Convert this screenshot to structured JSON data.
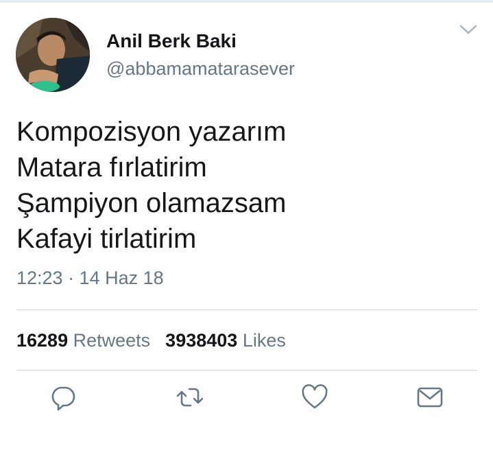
{
  "user": {
    "name": "Anil Berk Baki",
    "handle": "@abbamamatarasever",
    "avatar_icon": "profile-photo"
  },
  "tweet": {
    "lines": [
      "Kompozisyon yazarım",
      "Matara fırlatirim",
      "Şampiyon olamazsam",
      "Kafayi tirlatirim"
    ],
    "timestamp": "12:23 · 14 Haz 18"
  },
  "stats": {
    "retweets_count": "16289",
    "retweets_label": "Retweets",
    "likes_count": "3938403",
    "likes_label": "Likes"
  },
  "actions": {
    "icons": [
      "reply-icon",
      "retweet-icon",
      "like-icon",
      "share-icon"
    ]
  },
  "colors": {
    "primary_text": "#14171a",
    "secondary_text": "#657786",
    "divider": "#ccd6dd",
    "icon": "#657786"
  }
}
